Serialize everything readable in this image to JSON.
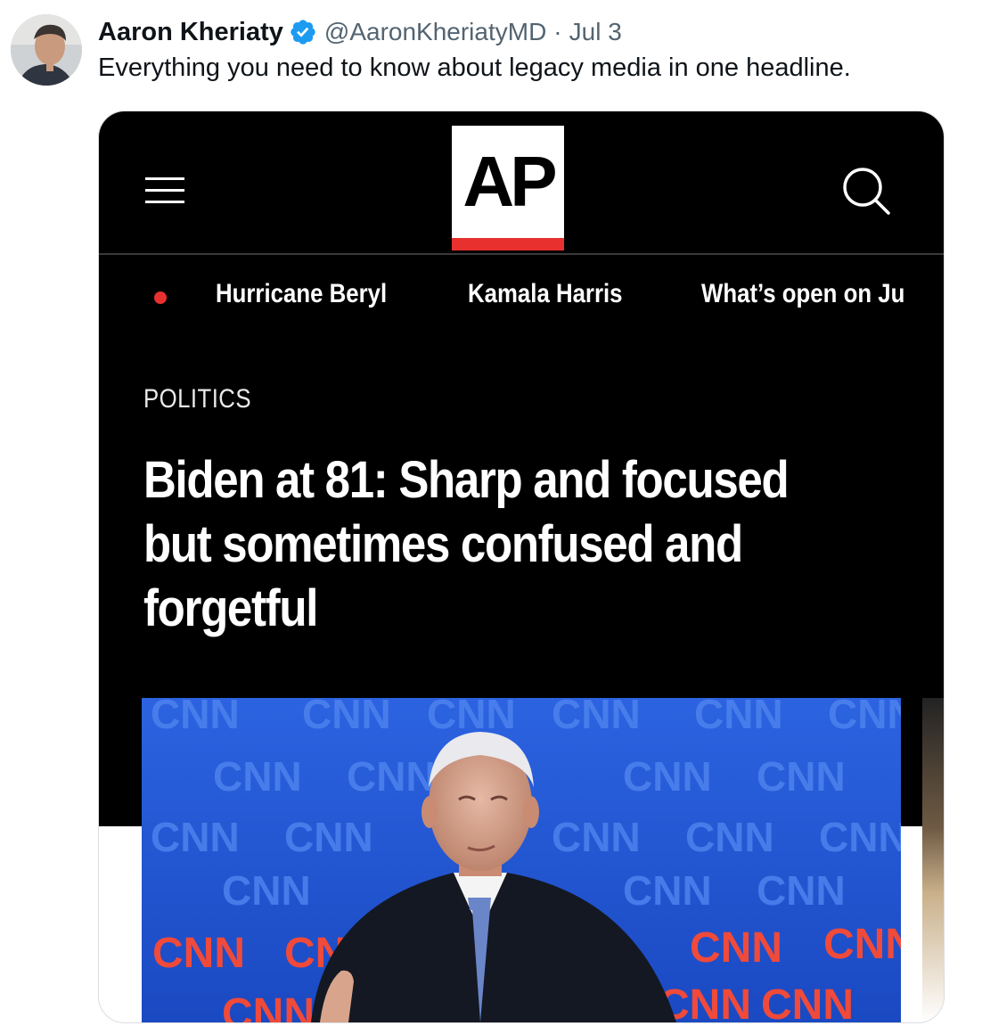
{
  "tweet": {
    "author_name": "Aaron Kheriaty",
    "handle": "@AaronKheriatyMD",
    "separator": "·",
    "date": "Jul 3",
    "text": "Everything you need to know about legacy media in one headline.",
    "verified": true,
    "avatar_icon": "profile-photo",
    "verified_color": "#1d9bf0"
  },
  "article_screenshot": {
    "logo_text": "AP",
    "logo_accent_color": "#e8312f",
    "menu_icon": "hamburger-menu-icon",
    "search_icon": "search-icon",
    "live_indicator_color": "#e8312f",
    "trending_topics": [
      "Hurricane Beryl",
      "Kamala Harris",
      "What’s open on Ju"
    ],
    "section": "POLITICS",
    "headline": "Biden at 81: Sharp and focused but sometimes confused and forgetful",
    "photo_backdrop_text": "CNN",
    "photo_backdrop_color": "#1f58d8"
  }
}
